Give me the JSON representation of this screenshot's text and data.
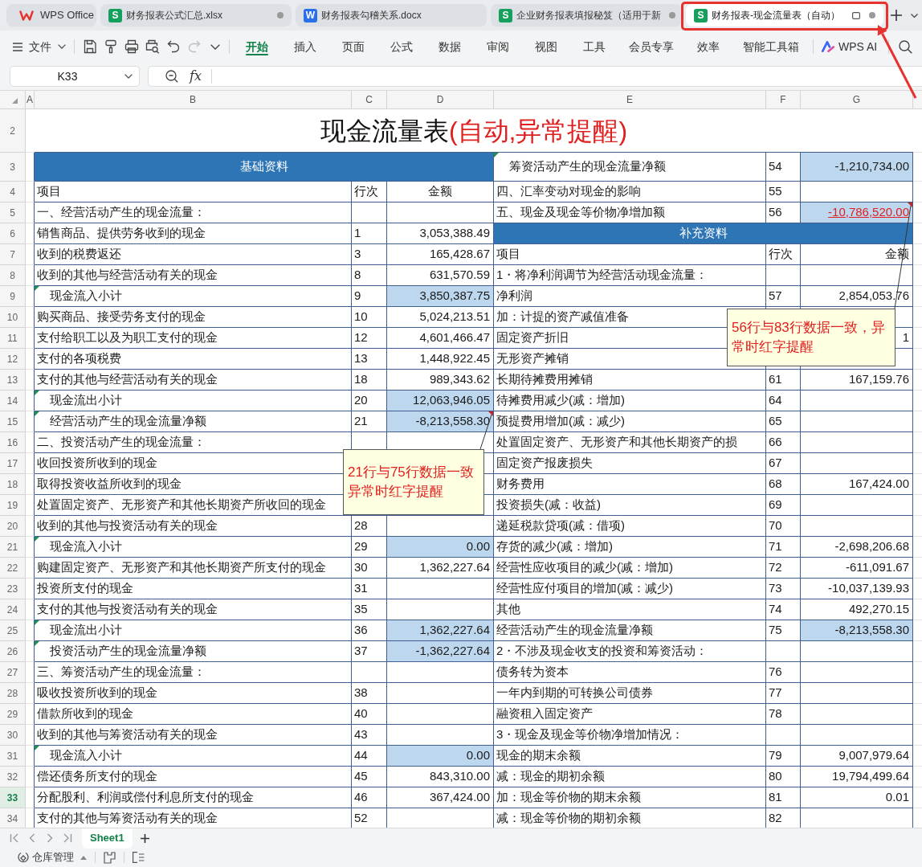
{
  "tabs": [
    {
      "kind": "home",
      "label": "WPS Office",
      "selected": false,
      "modified": false
    },
    {
      "kind": "sheet",
      "badge": "S",
      "label": "财务报表公式汇总.xlsx",
      "selected": false,
      "modified": true
    },
    {
      "kind": "doc",
      "badge": "W",
      "label": "财务报表勾稽关系.docx",
      "selected": false,
      "modified": false
    },
    {
      "kind": "sheet",
      "badge": "S",
      "label": "企业财务报表填报秘笈（适用于新",
      "selected": false,
      "modified": true
    },
    {
      "kind": "sheet",
      "badge": "S",
      "label": "财务报表-现金流量表（自动）",
      "selected": true,
      "modified": true
    }
  ],
  "toolbar": {
    "file_menu": "文件",
    "ribbon_tabs": [
      {
        "label": "开始",
        "selected": true
      },
      {
        "label": "插入",
        "selected": false
      },
      {
        "label": "页面",
        "selected": false
      },
      {
        "label": "公式",
        "selected": false
      },
      {
        "label": "数据",
        "selected": false
      },
      {
        "label": "审阅",
        "selected": false
      },
      {
        "label": "视图",
        "selected": false
      },
      {
        "label": "工具",
        "selected": false
      },
      {
        "label": "会员专享",
        "selected": false
      },
      {
        "label": "效率",
        "selected": false
      },
      {
        "label": "智能工具箱",
        "selected": false
      }
    ],
    "ai_button": "WPS AI"
  },
  "formula_bar": {
    "cell_ref": "K33",
    "function_button": "fx"
  },
  "columns": [
    "A",
    "B",
    "C",
    "D",
    "E",
    "F",
    "G"
  ],
  "title": {
    "row": "2",
    "text": "现金流量表",
    "note": "(自动,异常提醒)"
  },
  "rows": [
    {
      "row": "3",
      "selected": false,
      "left": {
        "kind": "banner",
        "text": "基础资料"
      },
      "right": {
        "kind": "subtotal",
        "item": "筹资活动产生的现金流量净额",
        "line": "54",
        "amount": "-1,210,734.00"
      }
    },
    {
      "row": "4",
      "selected": false,
      "left": {
        "kind": "header",
        "item": "项目",
        "line": "行次",
        "amount": "金额"
      },
      "right": {
        "kind": "item",
        "item": "四、汇率变动对现金的影响",
        "line": "55"
      }
    },
    {
      "row": "5",
      "selected": false,
      "left": {
        "kind": "item",
        "item": "一、经营活动产生的现金流量："
      },
      "right": {
        "kind": "alert",
        "item": "五、现金及现金等价物净增加额",
        "line": "56",
        "amount": "-10,786,520.00",
        "comment": [
          "56行与83行数据一致，异",
          "常时红字提醒"
        ]
      }
    },
    {
      "row": "6",
      "selected": false,
      "left": {
        "kind": "item",
        "item": "销售商品、提供劳务收到的现金",
        "line": "1",
        "amount": "3,053,388.49"
      },
      "right": {
        "kind": "banner",
        "text": "补充资料"
      }
    },
    {
      "row": "7",
      "selected": false,
      "left": {
        "kind": "item",
        "item": "收到的税费返还",
        "line": "3",
        "amount": "165,428.67"
      },
      "right": {
        "kind": "header",
        "item": "项目",
        "line": "行次",
        "amount": "金额"
      }
    },
    {
      "row": "8",
      "selected": false,
      "left": {
        "kind": "item",
        "item": "收到的其他与经营活动有关的现金",
        "line": "8",
        "amount": "631,570.59"
      },
      "right": {
        "kind": "item",
        "item": "1・将净利润调节为经营活动现金流量："
      }
    },
    {
      "row": "9",
      "selected": false,
      "left": {
        "kind": "subtotal",
        "item": "现金流入小计",
        "line": "9",
        "amount": "3,850,387.75"
      },
      "right": {
        "kind": "item",
        "item": "净利润",
        "line": "57",
        "amount": "2,854,053.76"
      }
    },
    {
      "row": "10",
      "selected": false,
      "left": {
        "kind": "item",
        "item": "购买商品、接受劳务支付的现金",
        "line": "10",
        "amount": "5,024,213.51"
      },
      "right": {
        "kind": "item",
        "item": "加：计提的资产减值准备"
      }
    },
    {
      "row": "11",
      "selected": false,
      "left": {
        "kind": "item",
        "item": "支付给职工以及为职工支付的现金",
        "line": "12",
        "amount": "4,601,466.47"
      },
      "right": {
        "kind": "item",
        "item": "固定资产折旧",
        "amount": "1"
      }
    },
    {
      "row": "12",
      "selected": false,
      "left": {
        "kind": "item",
        "item": "支付的各项税费",
        "line": "13",
        "amount": "1,448,922.45"
      },
      "right": {
        "kind": "item",
        "item": "无形资产摊销"
      }
    },
    {
      "row": "13",
      "selected": false,
      "left": {
        "kind": "item",
        "item": "支付的其他与经营活动有关的现金",
        "line": "18",
        "amount": "989,343.62"
      },
      "right": {
        "kind": "item",
        "item": "长期待摊费用摊销",
        "line": "61",
        "amount": "167,159.76"
      }
    },
    {
      "row": "14",
      "selected": false,
      "left": {
        "kind": "subtotal",
        "item": "现金流出小计",
        "line": "20",
        "amount": "12,063,946.05"
      },
      "right": {
        "kind": "item",
        "item": "待摊费用减少(减：增加)",
        "line": "64"
      }
    },
    {
      "row": "15",
      "selected": false,
      "left": {
        "kind": "subtotal",
        "item": "经营活动产生的现金流量净额",
        "line": "21",
        "amount": "-8,213,558.30",
        "comment": [
          "21行与75行数据一致",
          "异常时红字提醒"
        ]
      },
      "right": {
        "kind": "item",
        "item": "预提费用增加(减：减少)",
        "line": "65"
      }
    },
    {
      "row": "16",
      "selected": false,
      "left": {
        "kind": "item",
        "item": "二、投资活动产生的现金流量："
      },
      "right": {
        "kind": "item",
        "item": "处置固定资产、无形资产和其他长期资产的损",
        "line": "66"
      }
    },
    {
      "row": "17",
      "selected": false,
      "left": {
        "kind": "item",
        "item": "收回投资所收到的现金"
      },
      "right": {
        "kind": "item",
        "item": "固定资产报废损失",
        "line": "67"
      }
    },
    {
      "row": "18",
      "selected": false,
      "left": {
        "kind": "item",
        "item": "取得投资收益所收到的现金"
      },
      "right": {
        "kind": "item",
        "item": "财务费用",
        "line": "68",
        "amount": "167,424.00"
      }
    },
    {
      "row": "19",
      "selected": false,
      "left": {
        "kind": "item",
        "item": "处置固定资产、无形资产和其他长期资产所收回的现金"
      },
      "right": {
        "kind": "item",
        "item": "投资损失(减：收益)",
        "line": "69"
      }
    },
    {
      "row": "20",
      "selected": false,
      "left": {
        "kind": "item",
        "item": "收到的其他与投资活动有关的现金",
        "line": "28"
      },
      "right": {
        "kind": "item",
        "item": "递延税款贷项(减：借项)",
        "line": "70"
      }
    },
    {
      "row": "21",
      "selected": false,
      "left": {
        "kind": "subtotal",
        "item": "现金流入小计",
        "line": "29",
        "amount": "0.00"
      },
      "right": {
        "kind": "item",
        "item": "存货的减少(减：增加)",
        "line": "71",
        "amount": "-2,698,206.68"
      }
    },
    {
      "row": "22",
      "selected": false,
      "left": {
        "kind": "item",
        "item": "购建固定资产、无形资产和其他长期资产所支付的现金",
        "line": "30",
        "amount": "1,362,227.64"
      },
      "right": {
        "kind": "item",
        "item": "经营性应收项目的减少(减：增加)",
        "line": "72",
        "amount": "-611,091.67"
      }
    },
    {
      "row": "23",
      "selected": false,
      "left": {
        "kind": "item",
        "item": "投资所支付的现金",
        "line": "31"
      },
      "right": {
        "kind": "item",
        "item": "经营性应付项目的增加(减：减少)",
        "line": "73",
        "amount": "-10,037,139.93"
      }
    },
    {
      "row": "24",
      "selected": false,
      "left": {
        "kind": "item",
        "item": "支付的其他与投资活动有关的现金",
        "line": "35"
      },
      "right": {
        "kind": "item",
        "item": "其他",
        "line": "74",
        "amount": "492,270.15"
      }
    },
    {
      "row": "25",
      "selected": false,
      "left": {
        "kind": "subtotal",
        "item": "现金流出小计",
        "line": "36",
        "amount": "1,362,227.64"
      },
      "right": {
        "kind": "total",
        "item": "经营活动产生的现金流量净额",
        "line": "75",
        "amount": "-8,213,558.30"
      }
    },
    {
      "row": "26",
      "selected": false,
      "left": {
        "kind": "subtotal",
        "item": "投资活动产生的现金流量净额",
        "line": "37",
        "amount": "-1,362,227.64"
      },
      "right": {
        "kind": "item",
        "item": "2・不涉及现金收支的投资和筹资活动："
      }
    },
    {
      "row": "27",
      "selected": false,
      "left": {
        "kind": "item",
        "item": "三、筹资活动产生的现金流量："
      },
      "right": {
        "kind": "item",
        "item": "债务转为资本",
        "line": "76"
      }
    },
    {
      "row": "28",
      "selected": false,
      "left": {
        "kind": "item",
        "item": "吸收投资所收到的现金",
        "line": "38"
      },
      "right": {
        "kind": "item",
        "item": "一年内到期的可转换公司债券",
        "line": "77"
      }
    },
    {
      "row": "29",
      "selected": false,
      "left": {
        "kind": "item",
        "item": "借款所收到的现金",
        "line": "40"
      },
      "right": {
        "kind": "item",
        "item": "融资租入固定资产",
        "line": "78"
      }
    },
    {
      "row": "30",
      "selected": false,
      "left": {
        "kind": "item",
        "item": "收到的其他与筹资活动有关的现金",
        "line": "43"
      },
      "right": {
        "kind": "item",
        "item": "3・现金及现金等价物净增加情况："
      }
    },
    {
      "row": "31",
      "selected": false,
      "left": {
        "kind": "subtotal",
        "item": "现金流入小计",
        "line": "44",
        "amount": "0.00"
      },
      "right": {
        "kind": "item",
        "item": "现金的期末余额",
        "line": "79",
        "amount": "9,007,979.64"
      }
    },
    {
      "row": "32",
      "selected": false,
      "left": {
        "kind": "item",
        "item": "偿还债务所支付的现金",
        "line": "45",
        "amount": "843,310.00"
      },
      "right": {
        "kind": "item",
        "item": "减：现金的期初余额",
        "line": "80",
        "amount": "19,794,499.64"
      }
    },
    {
      "row": "33",
      "selected": true,
      "left": {
        "kind": "item",
        "item": "分配股利、利润或偿付利息所支付的现金",
        "line": "46",
        "amount": "367,424.00"
      },
      "right": {
        "kind": "item",
        "item": "加：现金等价物的期末余额",
        "line": "81",
        "amount": "0.01"
      }
    },
    {
      "row": "34",
      "selected": false,
      "left": {
        "kind": "item",
        "item": "支付的其他与筹资活动有关的现金",
        "line": "52"
      },
      "right": {
        "kind": "item",
        "item": "减：现金等价物的期初余额",
        "line": "82"
      }
    }
  ],
  "sheet_tabs": [
    {
      "label": "Sheet1",
      "selected": true
    }
  ],
  "status_bar": {
    "workspace": "仓库管理"
  }
}
